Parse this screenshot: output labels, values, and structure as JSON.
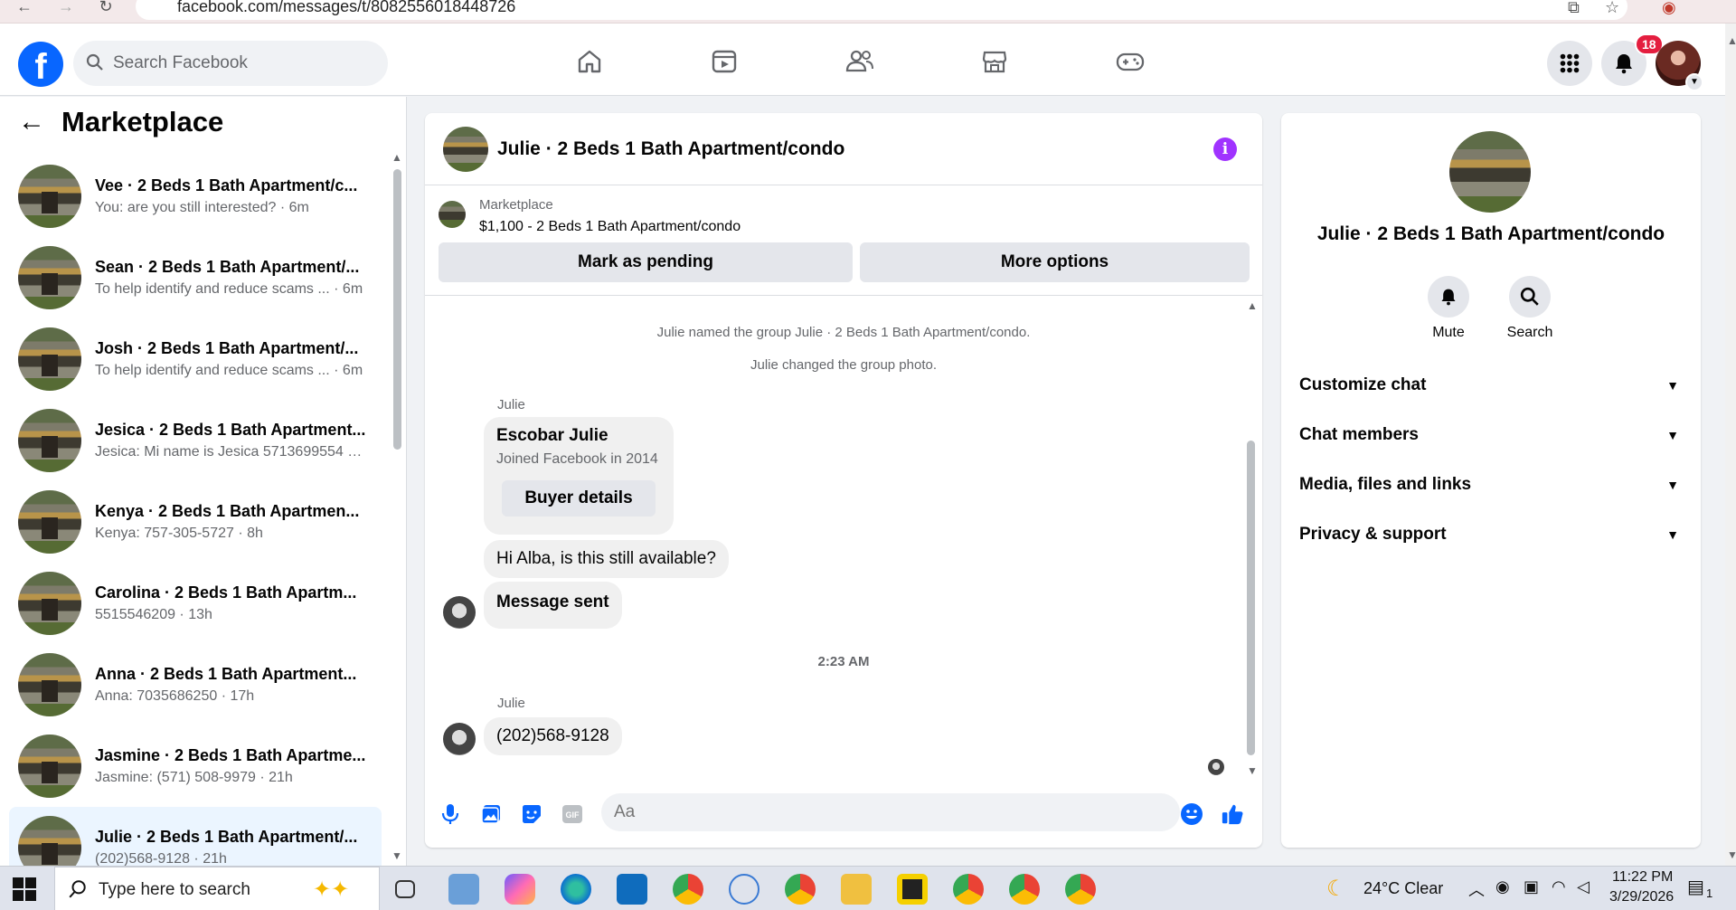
{
  "browser": {
    "url": "facebook.com/messages/t/8082556018448726"
  },
  "topbar": {
    "logo_letter": "f",
    "search_placeholder": "Search Facebook",
    "notification_count": "18"
  },
  "sidebar": {
    "title": "Marketplace",
    "conversations": [
      {
        "name": "Vee · 2 Beds 1 Bath Apartment/c...",
        "preview": "You: are you still interested? · 6m"
      },
      {
        "name": "Sean · 2 Beds 1 Bath Apartment/...",
        "preview": "To help identify and reduce scams ... · 6m"
      },
      {
        "name": "Josh · 2 Beds 1 Bath Apartment/...",
        "preview": "To help identify and reduce scams ... · 6m"
      },
      {
        "name": "Jesica · 2 Beds 1 Bath Apartment...",
        "preview": "Jesica: Mi name is Jesica 5713699554 · 8h"
      },
      {
        "name": "Kenya · 2 Beds 1 Bath Apartmen...",
        "preview": "Kenya: 757-305-5727 · 8h"
      },
      {
        "name": "Carolina · 2 Beds 1 Bath Apartm...",
        "preview": "5515546209 · 13h"
      },
      {
        "name": "Anna · 2 Beds 1 Bath Apartment...",
        "preview": "Anna: 7035686250 · 17h"
      },
      {
        "name": "Jasmine · 2 Beds 1 Bath Apartme...",
        "preview": "Jasmine: (571) 508-9979 · 21h"
      },
      {
        "name": "Julie · 2 Beds 1 Bath Apartment/...",
        "preview": "(202)568-9128 · 21h"
      }
    ]
  },
  "chat": {
    "title": "Julie · 2 Beds 1 Bath Apartment/condo",
    "marketplace_label": "Marketplace",
    "listing": "$1,100 - 2 Beds 1 Bath Apartment/condo",
    "mark_pending": "Mark as pending",
    "more_options": "More options",
    "system_1": "Julie named the group Julie · 2 Beds 1 Bath Apartment/condo.",
    "system_2": "Julie changed the group photo.",
    "sender_1": "Julie",
    "card_name": "Escobar Julie",
    "card_joined": "Joined Facebook in 2014",
    "buyer_details": "Buyer details",
    "msg_1": "Hi Alba, is this still available?",
    "msg_2": "Message sent",
    "timestamp": "2:23 AM",
    "sender_2": "Julie",
    "msg_3": "(202)568-9128",
    "composer_placeholder": "Aa"
  },
  "info": {
    "name": "Julie · 2 Beds 1 Bath Apartment/condo",
    "mute": "Mute",
    "search": "Search",
    "sections": [
      "Customize chat",
      "Chat members",
      "Media, files and links",
      "Privacy & support"
    ]
  },
  "taskbar": {
    "search_placeholder": "Type here to search",
    "weather": "24°C  Clear",
    "time": "11:22 PM",
    "date": "3/29/2026",
    "notif": "1"
  }
}
